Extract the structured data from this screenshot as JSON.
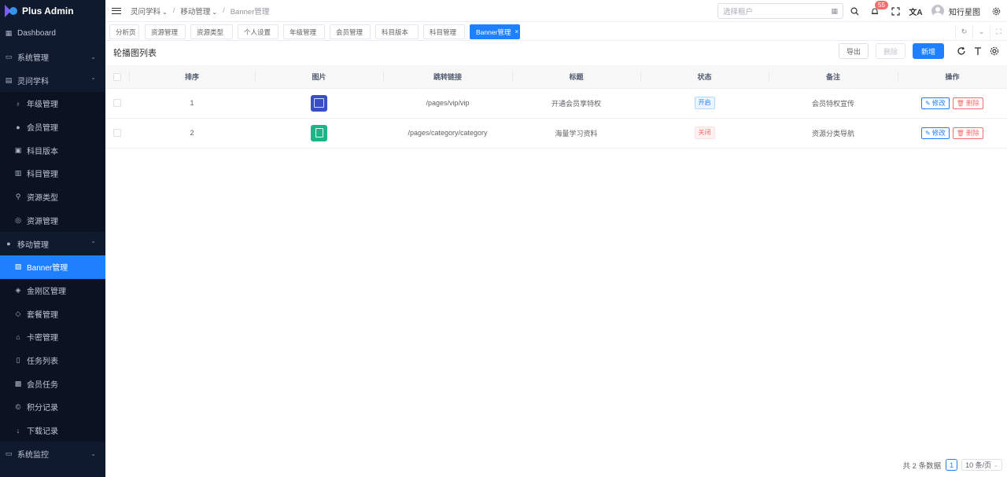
{
  "app": {
    "name": "Plus Admin"
  },
  "sidebar": {
    "items": [
      {
        "label": "Dashboard",
        "icon": "dashboard-icon",
        "level": "top",
        "arrow": ""
      },
      {
        "label": "系统管理",
        "icon": "monitor-icon",
        "level": "top",
        "arrow": "⌄"
      },
      {
        "label": "灵问学科",
        "icon": "document-icon",
        "level": "top",
        "arrow": "⌃"
      },
      {
        "label": "年级管理",
        "icon": "medal-icon",
        "level": "sub",
        "arrow": ""
      },
      {
        "label": "会员管理",
        "icon": "chat-icon",
        "level": "sub",
        "arrow": ""
      },
      {
        "label": "科目版本",
        "icon": "book-icon",
        "level": "sub",
        "arrow": ""
      },
      {
        "label": "科目管理",
        "icon": "reading-icon",
        "level": "sub",
        "arrow": ""
      },
      {
        "label": "资源类型",
        "icon": "link-icon",
        "level": "sub",
        "arrow": ""
      },
      {
        "label": "资源管理",
        "icon": "globe-icon",
        "level": "sub",
        "arrow": ""
      },
      {
        "label": "移动管理",
        "icon": "chat-icon",
        "level": "top",
        "arrow": "⌃"
      },
      {
        "label": "Banner管理",
        "icon": "picture-icon",
        "level": "sub",
        "arrow": "",
        "active": true
      },
      {
        "label": "金刚区管理",
        "icon": "grid-icon",
        "level": "sub",
        "arrow": ""
      },
      {
        "label": "套餐管理",
        "icon": "package-icon",
        "level": "sub",
        "arrow": ""
      },
      {
        "label": "卡密管理",
        "icon": "lock-icon",
        "level": "sub",
        "arrow": ""
      },
      {
        "label": "任务列表",
        "icon": "list-icon",
        "level": "sub",
        "arrow": ""
      },
      {
        "label": "会员任务",
        "icon": "tasks-icon",
        "level": "sub",
        "arrow": ""
      },
      {
        "label": "积分记录",
        "icon": "coin-icon",
        "level": "sub",
        "arrow": ""
      },
      {
        "label": "下载记录",
        "icon": "download-icon",
        "level": "sub",
        "arrow": ""
      },
      {
        "label": "系统监控",
        "icon": "monitor-icon",
        "level": "top",
        "arrow": "⌄"
      }
    ]
  },
  "header": {
    "breadcrumb": [
      {
        "label": "灵问学科",
        "caret": "⌄"
      },
      {
        "label": "移动管理",
        "caret": "⌄"
      },
      {
        "label": "Banner管理",
        "caret": ""
      }
    ],
    "breadcrumb_sep": "/",
    "tenant_placeholder": "选择租户",
    "notification_count": "55",
    "username": "知行星图"
  },
  "tabs": [
    {
      "label": "分析页",
      "active": false
    },
    {
      "label": "资源管理",
      "active": false
    },
    {
      "label": "资源类型",
      "active": false
    },
    {
      "label": "个人设置",
      "active": false
    },
    {
      "label": "年级管理",
      "active": false
    },
    {
      "label": "会员管理",
      "active": false
    },
    {
      "label": "科目版本",
      "active": false
    },
    {
      "label": "科目管理",
      "active": false
    },
    {
      "label": "Banner管理",
      "active": true
    }
  ],
  "main": {
    "title": "轮播图列表",
    "toolbar": {
      "export_label": "导出",
      "delete_label": "删除",
      "add_label": "新增"
    },
    "columns": [
      "排序",
      "图片",
      "跳转链接",
      "标题",
      "状态",
      "备注",
      "操作"
    ],
    "rows": [
      {
        "sort": "1",
        "thumb": "blue",
        "link": "/pages/vip/vip",
        "title": "开通会员享特权",
        "status": "开启",
        "status_type": "on",
        "remark": "会员特权宣传"
      },
      {
        "sort": "2",
        "thumb": "green",
        "link": "/pages/category/category",
        "title": "海量学习资料",
        "status": "关闭",
        "status_type": "off",
        "remark": "资源分类导航"
      }
    ],
    "row_actions": {
      "edit": "修改",
      "delete": "删除"
    },
    "pagination": {
      "total_text": "共 2 条数据",
      "current_page": "1",
      "page_size": "10 条/页"
    }
  },
  "colors": {
    "primary": "#1e80ff",
    "danger": "#f56c6c",
    "sidebar_bg": "#101a2e"
  }
}
